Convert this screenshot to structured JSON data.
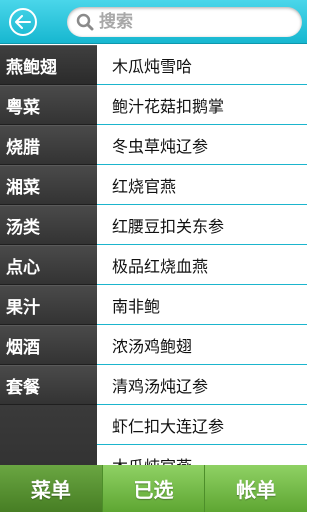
{
  "header": {
    "back_icon": "back-arrow-icon",
    "search": {
      "placeholder": "搜索",
      "value": "",
      "icon": "search-icon"
    }
  },
  "sidebar": {
    "items": [
      {
        "label": "燕鲍翅"
      },
      {
        "label": "粤菜"
      },
      {
        "label": "烧腊"
      },
      {
        "label": "湘菜"
      },
      {
        "label": "汤类"
      },
      {
        "label": "点心"
      },
      {
        "label": "果汁"
      },
      {
        "label": "烟酒"
      },
      {
        "label": "套餐"
      }
    ]
  },
  "main": {
    "items": [
      {
        "label": "木瓜炖雪哈"
      },
      {
        "label": "鲍汁花菇扣鹅掌"
      },
      {
        "label": "冬虫草炖辽参"
      },
      {
        "label": "红烧官燕"
      },
      {
        "label": "红腰豆扣关东参"
      },
      {
        "label": "极品红烧血燕"
      },
      {
        "label": "南非鲍"
      },
      {
        "label": "浓汤鸡鲍翅"
      },
      {
        "label": "清鸡汤炖辽参"
      },
      {
        "label": "虾仁扣大连辽参"
      },
      {
        "label": "木瓜炖官燕"
      }
    ]
  },
  "tabbar": {
    "tabs": [
      {
        "label": "菜单",
        "active": true
      },
      {
        "label": "已选",
        "active": false
      },
      {
        "label": "帐单",
        "active": false
      }
    ]
  },
  "colors": {
    "header_top": "#4ad6ea",
    "header_bottom": "#17b7d0",
    "divider": "#1bb5cd",
    "sidebar": "#3d3d3d",
    "tab_green": "#6fb83f"
  }
}
